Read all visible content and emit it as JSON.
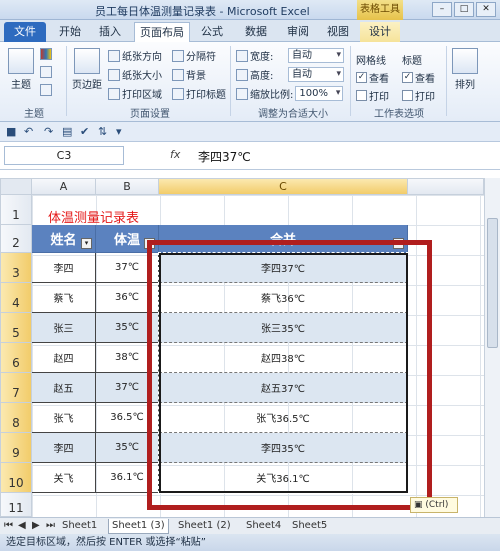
{
  "window": {
    "title": "员工每日体温测量记录表 - Microsoft Excel",
    "context_tools": "表格工具"
  },
  "tabs": [
    "文件",
    "开始",
    "插入",
    "页面布局",
    "公式",
    "数据",
    "审阅",
    "视图",
    "设计"
  ],
  "ribbon": {
    "themes": {
      "btn": "主题",
      "group": "主题",
      "color_icon": "color-palette-icon"
    },
    "page_setup": {
      "margins": "页边距",
      "orientation": "纸张方向",
      "size": "纸张大小",
      "print_area": "打印区域",
      "breaks": "分隔符",
      "background": "背景",
      "print_titles": "打印标题",
      "group": "页面设置"
    },
    "scale_to_fit": {
      "width_label": "宽度:",
      "width_value": "自动",
      "height_label": "高度:",
      "height_value": "自动",
      "scale_label": "缩放比例:",
      "scale_value": "100%",
      "group": "调整为合适大小"
    },
    "sheet_options": {
      "gridlines": "网格线",
      "headings": "标题",
      "view": "查看",
      "print": "打印",
      "group": "工作表选项"
    },
    "arrange": "排列"
  },
  "formula_bar": {
    "name_box": "C3",
    "fx": "fx",
    "content": "李四37℃"
  },
  "columns": [
    "A",
    "B",
    "C"
  ],
  "rows": [
    "1",
    "2",
    "3",
    "4",
    "5",
    "6",
    "7",
    "8",
    "9",
    "10",
    "11"
  ],
  "table": {
    "title": "体温测量记录表",
    "headers": [
      "姓名",
      "体温",
      "合并"
    ],
    "rows": [
      [
        "李四",
        "37℃",
        "李四37℃"
      ],
      [
        "蔡飞",
        "36℃",
        "蔡飞36℃"
      ],
      [
        "张三",
        "35℃",
        "张三35℃"
      ],
      [
        "赵四",
        "38℃",
        "赵四38℃"
      ],
      [
        "赵五",
        "37℃",
        "赵五37℃"
      ],
      [
        "张飞",
        "36.5℃",
        "张飞36.5℃"
      ],
      [
        "李四",
        "35℃",
        "李四35℃"
      ],
      [
        "关飞",
        "36.1℃",
        "关飞36.1℃"
      ]
    ]
  },
  "paste_options": "(Ctrl)",
  "sheet_tabs": [
    "Sheet1",
    "Sheet1 (3)",
    "Sheet1 (2)",
    "Sheet4",
    "Sheet5"
  ],
  "status": "选定目标区域，然后按 ENTER 或选择“粘贴”"
}
